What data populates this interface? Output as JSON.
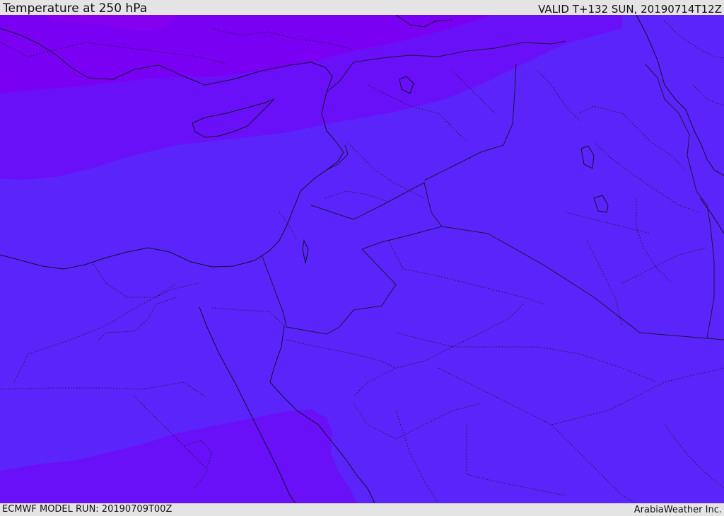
{
  "header": {
    "title": "Temperature at 250 hPa",
    "valid_time": "VALID T+132 SUN, 20190714T12Z"
  },
  "footer": {
    "model_run": "ECMWF MODEL RUN: 20190709T00Z",
    "provider": "ArabiaWeather Inc."
  },
  "map": {
    "variable": "temperature",
    "pressure_level": "250 hPa",
    "colors": {
      "band_warm": "#5b24fb",
      "band_mid": "#6a10f8",
      "band_cold": "#7a00f4",
      "band_coldest": "#8400ef",
      "coastline": "#101030",
      "border": "#1a1640"
    }
  }
}
